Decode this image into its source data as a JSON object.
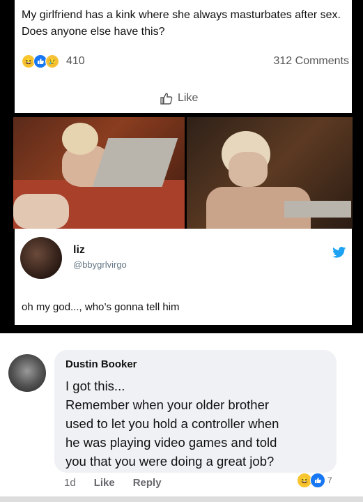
{
  "post": {
    "text": "My girlfriend has a kink where she always masturbates after sex. Does anyone else have this?",
    "reaction_count": "410",
    "comments": "312 Comments",
    "like_label": "Like"
  },
  "tweet": {
    "name": "liz",
    "handle": "@bbygrlvirgo",
    "text": "oh my god..., who’s gonna tell him"
  },
  "comment": {
    "author": "Dustin Booker",
    "lines": [
      "I got this...",
      "Remember when your older brother",
      "used to let you hold a controller when",
      "he was playing video games and told",
      "you that you were doing a great job?"
    ],
    "time": "1d",
    "like_label": "Like",
    "reply_label": "Reply",
    "reaction_count": "7"
  },
  "icons": {
    "post_reactions": [
      "haha-icon",
      "like-icon",
      "sad-icon"
    ],
    "comment_reactions": [
      "haha-icon",
      "like-icon"
    ],
    "twitter": "twitter-bird-icon"
  },
  "colors": {
    "facebook_blue": "#1877f2",
    "twitter_blue": "#1da1f2",
    "bubble_bg": "#eff1f4"
  }
}
